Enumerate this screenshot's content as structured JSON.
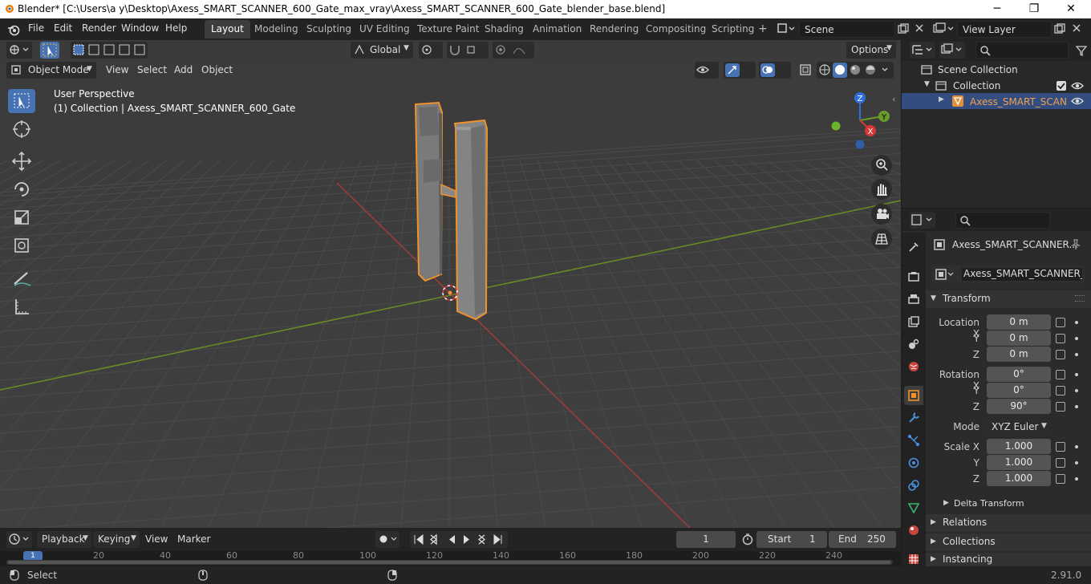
{
  "window": {
    "title": "Blender* [C:\\Users\\a y\\Desktop\\Axess_SMART_SCANNER_600_Gate_max_vray\\Axess_SMART_SCANNER_600_Gate_blender_base.blend]",
    "minimize": "─",
    "maximize": "❐",
    "close": "✕"
  },
  "menubar": {
    "items": [
      "File",
      "Edit",
      "Render",
      "Window",
      "Help"
    ]
  },
  "workspaces": [
    "Layout",
    "Modeling",
    "Sculpting",
    "UV Editing",
    "Texture Paint",
    "Shading",
    "Animation",
    "Rendering",
    "Compositing",
    "Scripting"
  ],
  "scene": {
    "name": "Scene",
    "view_layer": "View Layer"
  },
  "viewport_header": {
    "orientation": "Global",
    "options": "Options",
    "mode": "Object Mode",
    "menus": [
      "View",
      "Select",
      "Add",
      "Object"
    ]
  },
  "viewport": {
    "perspective": "User Perspective",
    "collection_info": "(1) Collection | Axess_SMART_SCANNER_600_Gate",
    "gizmo": {
      "z": "Z",
      "y": "Y",
      "x": "X"
    }
  },
  "timeline": {
    "playback": "Playback",
    "keying": "Keying",
    "view": "View",
    "marker": "Marker",
    "current_frame": "1",
    "start_label": "Start",
    "start": "1",
    "end_label": "End",
    "end": "250",
    "ticks": [
      "1",
      "20",
      "40",
      "60",
      "80",
      "100",
      "120",
      "140",
      "160",
      "180",
      "200",
      "220",
      "240"
    ]
  },
  "outliner": {
    "scene_collection": "Scene Collection",
    "collection": "Collection",
    "object": "Axess_SMART_SCAN"
  },
  "properties": {
    "object_name": "Axess_SMART_SCANNER...",
    "object_field": "Axess_SMART_SCANNER_6...",
    "transform": "Transform",
    "location_label": "Location X",
    "rotation_label": "Rotation X",
    "scale_label": "Scale X",
    "y_label": "Y",
    "z_label": "Z",
    "location": [
      "0 m",
      "0 m",
      "0 m"
    ],
    "rotation": [
      "0°",
      "0°",
      "90°"
    ],
    "mode_label": "Mode",
    "mode": "XYZ Euler",
    "scale": [
      "1.000",
      "1.000",
      "1.000"
    ],
    "delta_transform": "Delta Transform",
    "relations": "Relations",
    "collections": "Collections",
    "instancing": "Instancing"
  },
  "statusbar": {
    "select": "Select",
    "version": "2.91.0"
  },
  "colors": {
    "accent": "#4772b3",
    "selection": "#f0922b",
    "grid_x_axis": "#a33b3b",
    "grid_y_axis": "#6b8e23"
  }
}
